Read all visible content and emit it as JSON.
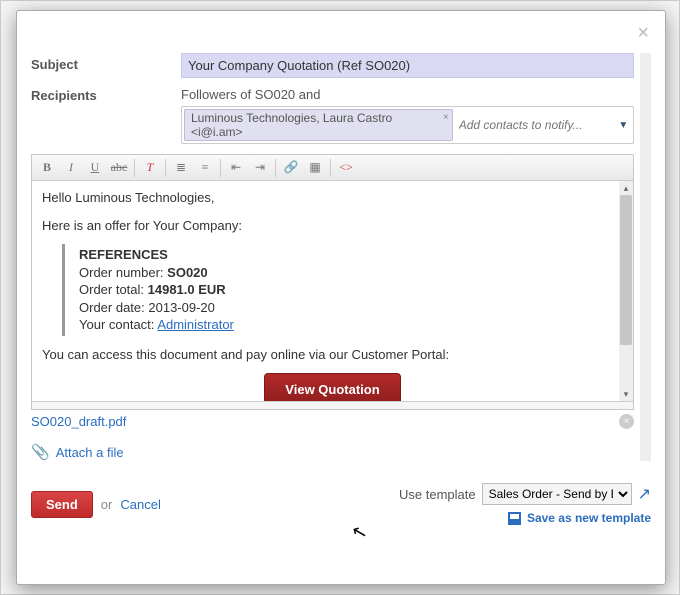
{
  "labels": {
    "subject": "Subject",
    "recipients": "Recipients"
  },
  "subject_value": "Your Company Quotation (Ref SO020)",
  "followers_text": "Followers of SO020  and",
  "recipient_tag": "Luminous Technologies, Laura Castro <i@i.am>",
  "recipient_placeholder": "Add contacts to notify...",
  "body": {
    "greeting": "Hello Luminous Technologies,",
    "intro": "Here is an offer for Your Company:",
    "refs_heading": "REFERENCES",
    "order_number_label": "Order number: ",
    "order_number": "SO020",
    "order_total_label": "Order total: ",
    "order_total": "14981.0 EUR",
    "order_date_label": "Order date: ",
    "order_date": "2013-09-20",
    "contact_label": "Your contact: ",
    "contact_name": "Administrator",
    "portal_line": "You can access this document and pay online via our Customer Portal:",
    "view_button": "View Quotation"
  },
  "attachment": "SO020_draft.pdf",
  "attach_label": "Attach a file",
  "footer": {
    "send": "Send",
    "or": "or",
    "cancel": "Cancel",
    "use_template": "Use template",
    "template_selected": "Sales Order - Send by Email",
    "save_template": "Save as new template"
  }
}
